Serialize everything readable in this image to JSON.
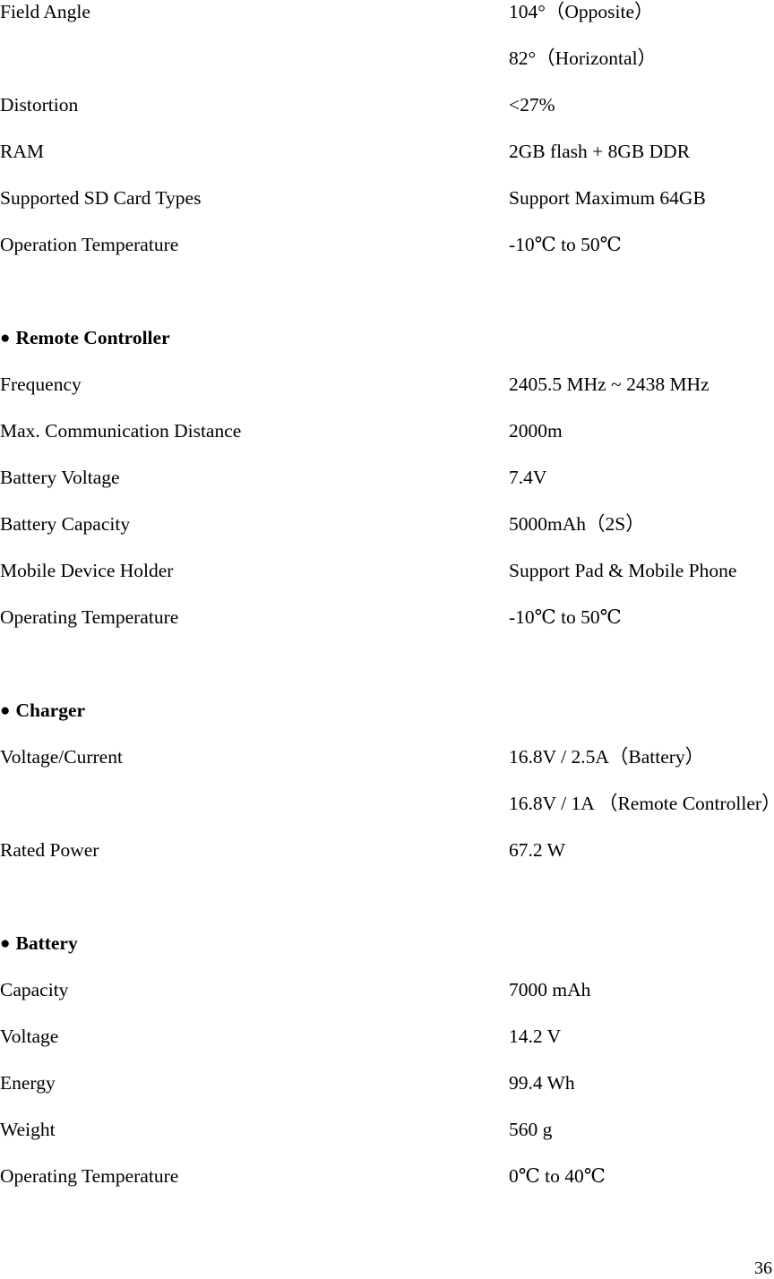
{
  "document": {
    "page_number": "36",
    "rows": [
      {
        "type": "spec",
        "label": "Field Angle",
        "value": "104°（Opposite）"
      },
      {
        "type": "spec",
        "label": "",
        "value": "82°（Horizontal）"
      },
      {
        "type": "spec",
        "label": "Distortion",
        "value": "<27%"
      },
      {
        "type": "spec",
        "label": "RAM",
        "value": "2GB flash + 8GB DDR"
      },
      {
        "type": "spec",
        "label": "Supported SD Card Types",
        "value": "Support Maximum 64GB"
      },
      {
        "type": "spec",
        "label": "Operation Temperature",
        "value": "-10℃ to 50℃"
      },
      {
        "type": "spacer",
        "label": "",
        "value": ""
      },
      {
        "type": "section",
        "label": "Remote Controller",
        "value": ""
      },
      {
        "type": "spec",
        "label": "Frequency",
        "value": "2405.5 MHz ~ 2438 MHz"
      },
      {
        "type": "spec",
        "label": "Max. Communication Distance",
        "value": "2000m"
      },
      {
        "type": "spec",
        "label": "Battery Voltage",
        "value": "7.4V"
      },
      {
        "type": "spec",
        "label": "Battery Capacity",
        "value": "5000mAh（2S）"
      },
      {
        "type": "spec",
        "label": "Mobile Device Holder",
        "value": "Support Pad & Mobile Phone"
      },
      {
        "type": "spec",
        "label": "Operating Temperature",
        "value": "-10℃ to 50℃"
      },
      {
        "type": "spacer",
        "label": "",
        "value": ""
      },
      {
        "type": "section",
        "label": "Charger",
        "value": ""
      },
      {
        "type": "spec",
        "label": "Voltage/Current",
        "value": "16.8V / 2.5A（Battery）"
      },
      {
        "type": "spec",
        "label": "",
        "value": "16.8V / 1A （Remote Controller）"
      },
      {
        "type": "spec",
        "label": "Rated Power",
        "value": "67.2 W"
      },
      {
        "type": "spacer",
        "label": "",
        "value": ""
      },
      {
        "type": "section",
        "label": "Battery",
        "value": ""
      },
      {
        "type": "spec",
        "label": "Capacity",
        "value": "7000 mAh"
      },
      {
        "type": "spec",
        "label": "Voltage",
        "value": "14.2 V"
      },
      {
        "type": "spec",
        "label": "Energy",
        "value": "99.4 Wh"
      },
      {
        "type": "spec",
        "label": "Weight",
        "value": "560 g"
      },
      {
        "type": "spec",
        "label": "Operating Temperature",
        "value": "0℃ to 40℃"
      }
    ],
    "bullet_glyph": "●"
  }
}
